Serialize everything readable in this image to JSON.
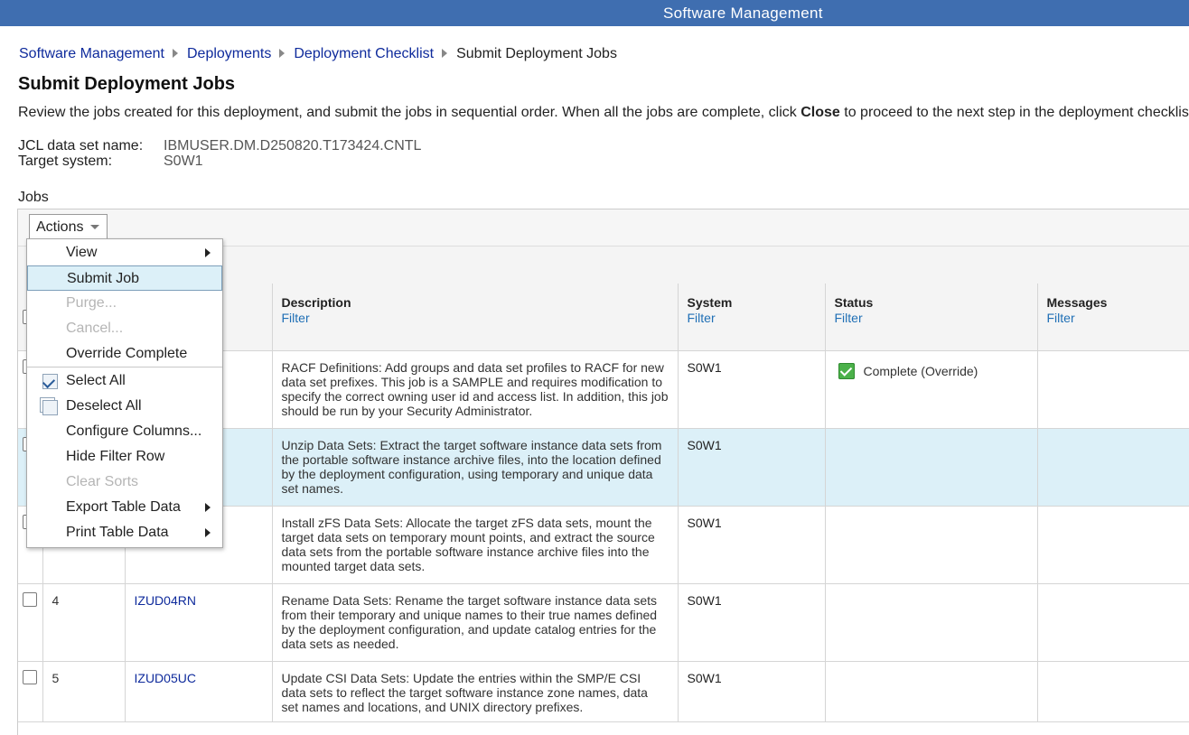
{
  "app": {
    "title": "Software Management"
  },
  "breadcrumb": [
    {
      "label": "Software Management"
    },
    {
      "label": "Deployments"
    },
    {
      "label": "Deployment Checklist"
    },
    {
      "label": "Submit Deployment Jobs"
    }
  ],
  "page": {
    "title": "Submit Deployment Jobs",
    "intro_before": "Review the jobs created for this deployment, and submit the jobs in sequential order. When all the jobs are complete, click ",
    "intro_bold": "Close",
    "intro_after": " to proceed to the next step in the deployment checklist."
  },
  "properties": {
    "jcl_label": "JCL data set name:",
    "jcl_value": "IBMUSER.DM.D250820.T173424.CNTL",
    "target_label": "Target system:",
    "target_value": "S0W1"
  },
  "jobs": {
    "label": "Jobs",
    "actions_label": "Actions",
    "columns": {
      "description": "Description",
      "system": "System",
      "status": "Status",
      "messages": "Messages",
      "filter": "Filter"
    },
    "rows": [
      {
        "num": "",
        "name": "",
        "description": "RACF Definitions: Add groups and data set profiles to RACF for new data set prefixes. This job is a SAMPLE and requires modification to specify the correct owning user id and access list. In addition, this job should be run by your Security Administrator.",
        "system": "S0W1",
        "status": "Complete (Override)",
        "messages": ""
      },
      {
        "num": "",
        "name": "",
        "description": "Unzip Data Sets: Extract the target software instance data sets from the portable software instance archive files, into the location defined by the deployment configuration, using temporary and unique data set names.",
        "system": "S0W1",
        "status": "",
        "messages": ""
      },
      {
        "num": "",
        "name": "",
        "description": "Install zFS Data Sets: Allocate the target zFS data sets, mount the target data sets on temporary mount points, and extract the source data sets from the portable software instance archive files into the mounted target data sets.",
        "system": "S0W1",
        "status": "",
        "messages": ""
      },
      {
        "num": "4",
        "name": "IZUD04RN",
        "description": "Rename Data Sets: Rename the target software instance data sets from their temporary and unique names to their true names defined by the deployment configuration, and update catalog entries for the data sets as needed.",
        "system": "S0W1",
        "status": "",
        "messages": ""
      },
      {
        "num": "5",
        "name": "IZUD05UC",
        "description": "Update CSI Data Sets: Update the entries within the SMP/E CSI data sets to reflect the target software instance zone names, data set names and locations, and UNIX directory prefixes.",
        "system": "S0W1",
        "status": "",
        "messages": ""
      }
    ]
  },
  "menu": {
    "items": [
      {
        "label": "View"
      },
      {
        "label": "Submit Job"
      },
      {
        "label": "Purge..."
      },
      {
        "label": "Cancel..."
      },
      {
        "label": "Override Complete"
      },
      {
        "label": "Select All"
      },
      {
        "label": "Deselect All"
      },
      {
        "label": "Configure Columns..."
      },
      {
        "label": "Hide Filter Row"
      },
      {
        "label": "Clear Sorts"
      },
      {
        "label": "Export Table Data"
      },
      {
        "label": "Print Table Data"
      }
    ]
  },
  "colors": {
    "header_bar": "#3f6eb0",
    "selected_row": "#dcf0f8",
    "link": "#0f2b9c",
    "filter_link": "#1f6fb5",
    "status_complete": "#4bb14a"
  }
}
